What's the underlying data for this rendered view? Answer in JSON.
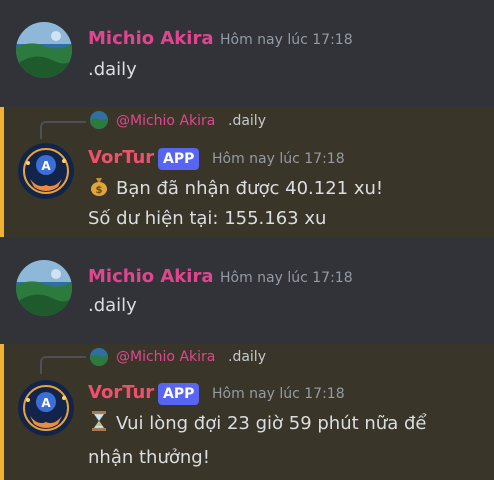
{
  "colors": {
    "background": "#313338",
    "highlight_bg": "#3a3529",
    "highlight_border": "#f0b232",
    "user_name": "#e0468f",
    "bot_name": "#f0506e",
    "app_badge": "#5865f2",
    "timestamp": "#949ba4"
  },
  "messages": [
    {
      "author": "Michio Akira",
      "timestamp": "Hôm nay lúc 17:18",
      "text": ".daily",
      "avatar": "landscape-avatar"
    },
    {
      "reply_to": {
        "author": "@Michio Akira",
        "text": ".daily"
      },
      "author": "VorTur",
      "badge": "APP",
      "timestamp": "Hôm nay lúc 17:18",
      "lines": [
        "Bạn đã nhận được 40.121 xu!",
        "Số dư hiện tại: 155.163 xu"
      ],
      "emoji": "money-bag-icon",
      "avatar": "bot-avatar"
    },
    {
      "author": "Michio Akira",
      "timestamp": "Hôm nay lúc 17:18",
      "text": ".daily",
      "avatar": "landscape-avatar"
    },
    {
      "reply_to": {
        "author": "@Michio Akira",
        "text": ".daily"
      },
      "author": "VorTur",
      "badge": "APP",
      "timestamp": "Hôm nay lúc 17:18",
      "lines": [
        "Vui lòng đợi 23 giờ 59 phút nữa để",
        "nhận thưởng!"
      ],
      "emoji": "hourglass-icon",
      "avatar": "bot-avatar"
    }
  ]
}
